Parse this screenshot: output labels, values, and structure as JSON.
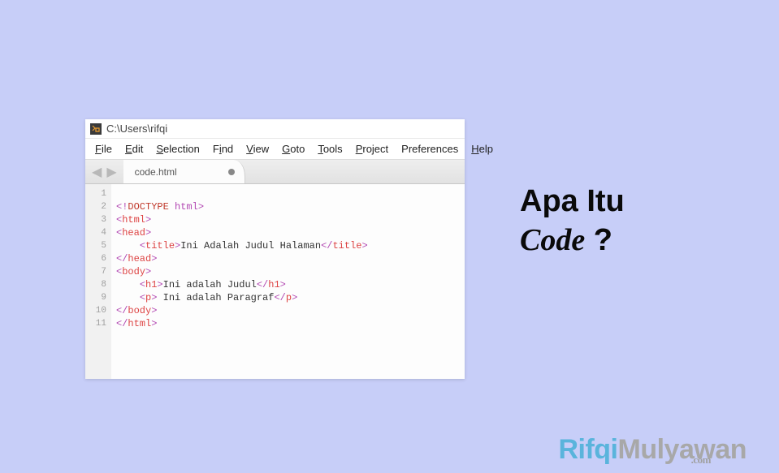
{
  "page": {
    "heading_line1": "Apa Itu",
    "heading_code": "Code",
    "heading_q": "?",
    "brand_first": "Rifqi",
    "brand_last": "Mulyawan",
    "brand_tld": ".com"
  },
  "editor": {
    "titlebar": "C:\\Users\\rifqi",
    "menu": [
      "File",
      "Edit",
      "Selection",
      "Find",
      "View",
      "Goto",
      "Tools",
      "Project",
      "Preferences",
      "Help"
    ],
    "tab_name": "code.html",
    "line_numbers": [
      "1",
      "2",
      "3",
      "4",
      "5",
      "6",
      "7",
      "8",
      "9",
      "10",
      "11"
    ],
    "code": {
      "l2_doctype": "DOCTYPE",
      "l2_html": "html",
      "l3_html": "html",
      "l4_head": "head",
      "l5_title": "title",
      "l5_text": "Ini Adalah Judul Halaman",
      "l5_title_c": "title",
      "l6_head_c": "head",
      "l7_body": "body",
      "l8_h1": "h1",
      "l8_text": "Ini adalah Judul",
      "l8_h1_c": "h1",
      "l9_p": "p",
      "l9_text": " Ini adalah Paragraf",
      "l9_p_c": "p",
      "l10_body_c": "body",
      "l11_html_c": "html"
    }
  }
}
